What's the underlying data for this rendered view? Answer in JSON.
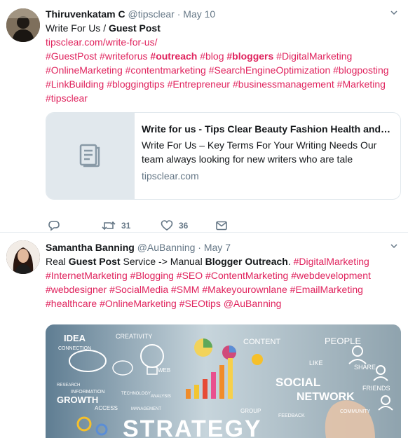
{
  "tweets": [
    {
      "name": "Thiruvenkatam C",
      "handle": "@tipsclear",
      "sep": "·",
      "date": "May 10",
      "line1_a": "Write For Us / ",
      "line1_b": "Guest Post",
      "url": "tipsclear.com/write-for-us/",
      "tags": [
        {
          "text": "#GuestPost",
          "bold": false
        },
        {
          "text": "#writeforus",
          "bold": false
        },
        {
          "text": "#outreach",
          "bold": true
        },
        {
          "text": "#blog",
          "bold": false
        },
        {
          "text": "#bloggers",
          "bold": true
        },
        {
          "text": "#DigitalMarketing",
          "bold": false
        },
        {
          "text": "#OnlineMarketing",
          "bold": false
        },
        {
          "text": "#contentmarketing",
          "bold": false
        },
        {
          "text": "#SearchEngineOptimization",
          "bold": false
        },
        {
          "text": "#blogposting",
          "bold": false
        },
        {
          "text": "#LinkBuilding",
          "bold": false
        },
        {
          "text": "#bloggingtips",
          "bold": false
        },
        {
          "text": "#Entrepreneur",
          "bold": false
        },
        {
          "text": "#businessmanagement",
          "bold": false
        },
        {
          "text": "#Marketing",
          "bold": false
        },
        {
          "text": "#tipsclear",
          "bold": false
        }
      ],
      "card": {
        "title": "Write for us - Tips Clear Beauty Fashion Health and…",
        "description": "Write For Us – Key Terms For Your Writing Needs Our team always looking for new writers who are tale",
        "domain": "tipsclear.com",
        "thumb_icon": "document-icon"
      },
      "actions": {
        "reply_count": "",
        "retweet_count": "31",
        "like_count": "36"
      }
    },
    {
      "name": "Samantha Banning",
      "handle": "@AuBanning",
      "sep": "·",
      "date": "May 7",
      "text_a": "Real ",
      "text_b": "Guest Post",
      "text_c": " Service -> Manual ",
      "text_d": "Blogger Outreach",
      "text_e": ". ",
      "tags": [
        "#DigitalMarketing",
        "#InternetMarketing",
        "#Blogging",
        "#SEO",
        "#ContentMarketing",
        "#webdevelopment",
        "#webdesigner",
        "#SocialMedia",
        "#SMM",
        "#Makeyourownlane",
        "#EmailMarketing",
        "#healthcare",
        "#OnlineMarketing",
        "#SEOtips",
        "@AuBanning"
      ],
      "image_words": {
        "idea": "IDEA",
        "creativity": "CREATIVITY",
        "connection": "CONNECTION",
        "content": "CONTENT",
        "people": "PEOPLE",
        "like": "LIKE",
        "share": "SHARE",
        "web": "WEB",
        "research": "RESEARCH",
        "information": "INFORMATION",
        "growth": "GROWTH",
        "access": "ACCESS",
        "technology": "TECHNOLOGY",
        "analysis": "ANALYSIS",
        "management": "MANAGEMENT",
        "social": "SOCIAL",
        "network": "NETWORK",
        "friends": "FRIENDS",
        "community": "COMMUNITY",
        "feedback": "FEEDBACK",
        "group": "GROUP",
        "strategy": "STRATEGY"
      }
    }
  ]
}
